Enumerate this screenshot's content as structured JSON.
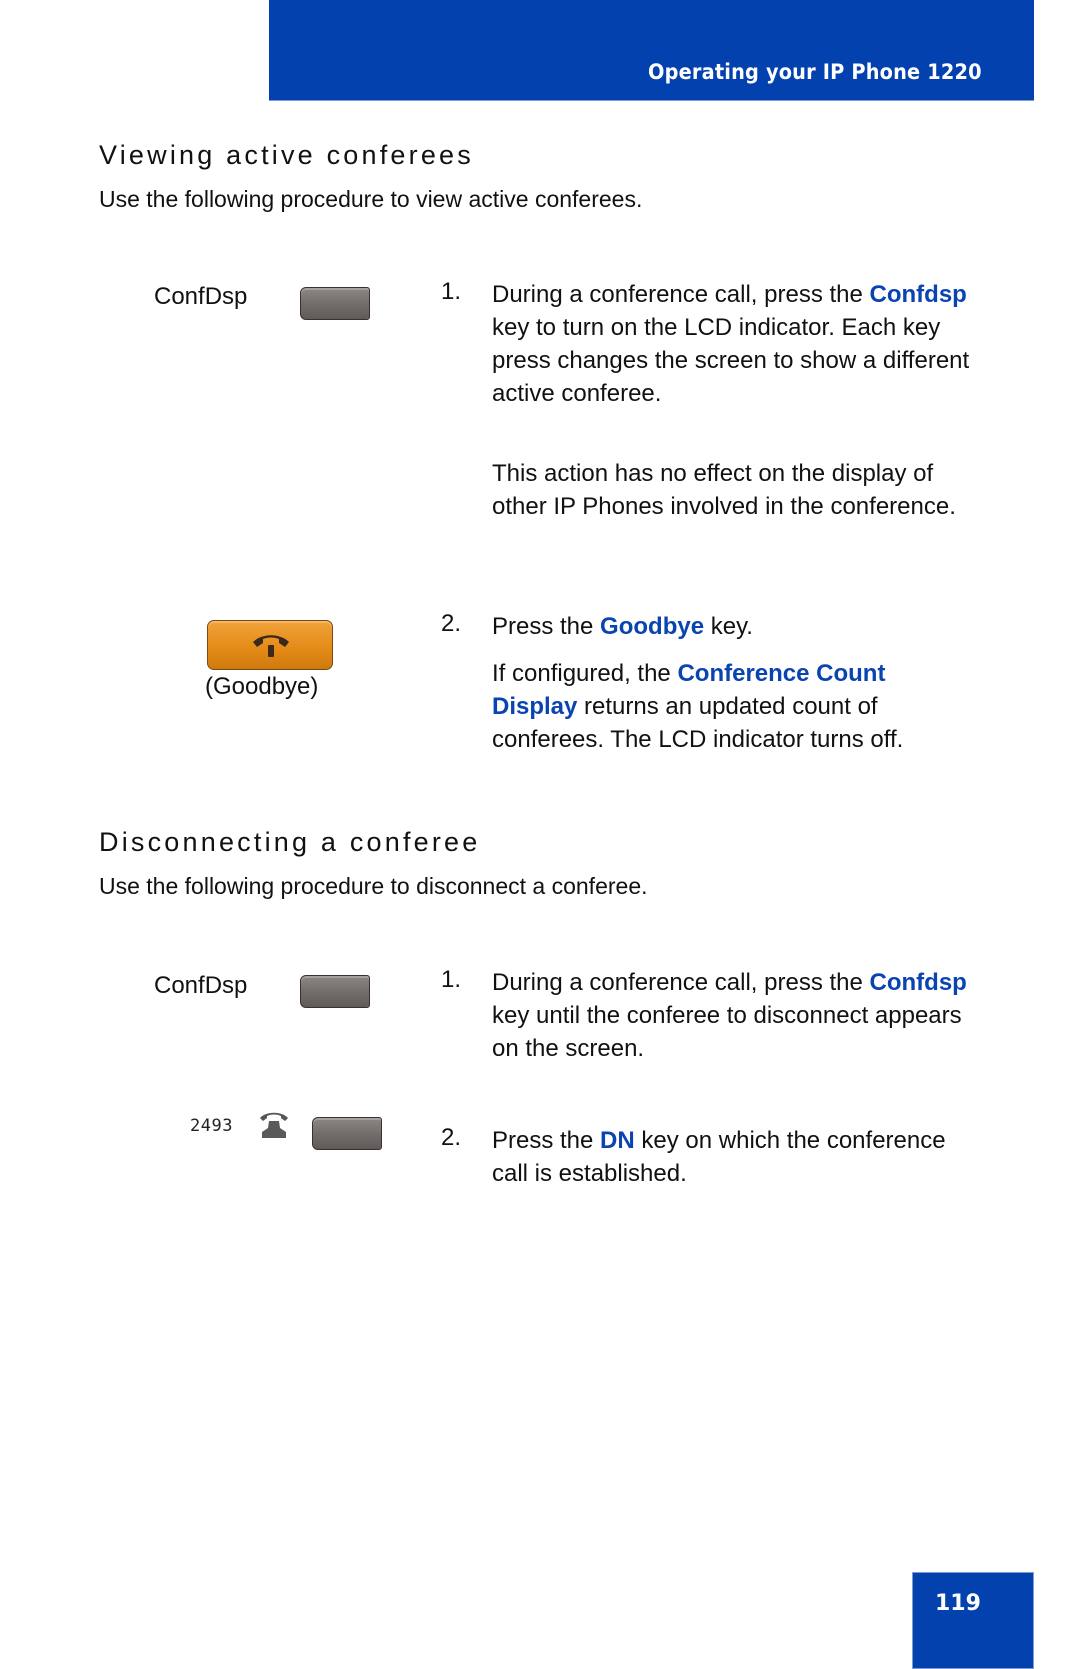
{
  "header": {
    "title": "Operating your IP Phone 1220",
    "band_color": "#0341ae"
  },
  "sections": [
    {
      "heading": "Viewing active conferees",
      "intro": "Use the following procedure to view active conferees.",
      "keys": {
        "confdsp_label": "ConfDsp",
        "goodbye_label": "(Goodbye)"
      },
      "steps": [
        {
          "number": "1.",
          "parts": [
            {
              "text": "During a conference call, press the "
            },
            {
              "text": "Confdsp",
              "highlight": true
            },
            {
              "text": " key to turn on the LCD indicator. Each key press changes the screen to show a different active conferee."
            }
          ],
          "note": "This action has no effect on the display of other IP Phones involved in the conference."
        },
        {
          "number": "2.",
          "parts": [
            {
              "text": "Press the "
            },
            {
              "text": "Goodbye",
              "highlight": true
            },
            {
              "text": " key."
            }
          ],
          "note_parts": [
            {
              "text": "If configured, the "
            },
            {
              "text": "Conference Count Display",
              "highlight": true
            },
            {
              "text": " returns an updated count of conferees. The LCD indicator turns off."
            }
          ]
        }
      ]
    },
    {
      "heading": "Disconnecting a conferee",
      "intro": "Use the following procedure to disconnect a conferee.",
      "keys": {
        "confdsp_label": "ConfDsp",
        "dn_number": "2493"
      },
      "steps": [
        {
          "number": "1.",
          "parts": [
            {
              "text": "During a conference call, press the "
            },
            {
              "text": "Confdsp",
              "highlight": true
            },
            {
              "text": " key until the conferee to disconnect appears on the screen."
            }
          ]
        },
        {
          "number": "2.",
          "parts": [
            {
              "text": "Press the "
            },
            {
              "text": "DN",
              "highlight": true
            },
            {
              "text": " key on which the conference call is established."
            }
          ]
        }
      ]
    }
  ],
  "footer": {
    "page_number": "119"
  },
  "colors": {
    "accent": "#0a44b0",
    "goodbye_key": "#e38a16",
    "soft_key": "#6f6c69"
  }
}
